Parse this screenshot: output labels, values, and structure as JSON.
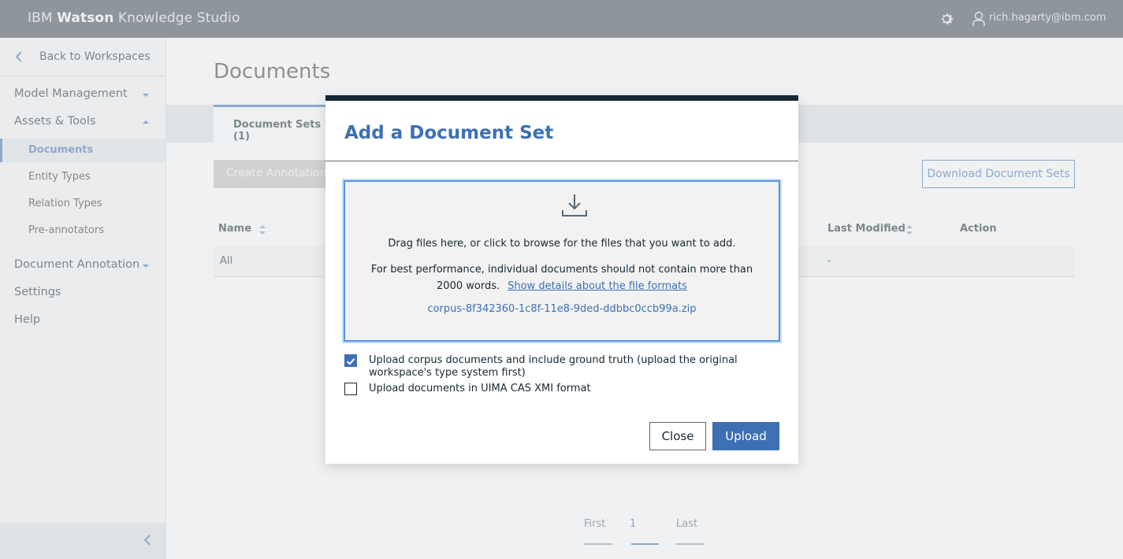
{
  "topbar": {
    "brand_prefix": "IBM ",
    "brand_bold": "Watson",
    "brand_suffix": " Knowledge Studio",
    "user_email": "rich.hagarty@ibm.com",
    "icons": [
      "gear-icon",
      "user-icon"
    ]
  },
  "sidebar": {
    "back_label": "Back to Workspaces",
    "sections": {
      "model_management": "Model Management",
      "assets_tools": "Assets & Tools",
      "document_annotation": "Document Annotation",
      "settings": "Settings",
      "help": "Help"
    },
    "sub_items": {
      "documents": "Documents",
      "entity_types": "Entity Types",
      "relation_types": "Relation Types",
      "pre_annotators": "Pre-annotators"
    }
  },
  "main": {
    "title": "Documents",
    "tab_label": "Document Sets (1)",
    "create_button": "Create Annotation Sets",
    "download_button": "Download Document Sets",
    "table": {
      "headers": {
        "name": "Name",
        "last_modified": "Last Modified",
        "action": "Action"
      },
      "rows": [
        {
          "name": "All",
          "last_modified": "-"
        }
      ]
    },
    "pager": {
      "first": "First",
      "page": "1",
      "last": "Last"
    }
  },
  "modal": {
    "title": "Add a Document Set",
    "dropzone_line1": "Drag files here, or click to browse for the files that you want to add.",
    "dropzone_line2": "For best performance, individual documents should not contain more than 2000 words.",
    "dropzone_link": "Show details about the file formats",
    "file_name": "corpus-8f342360-1c8f-11e8-9ded-ddbbc0ccb99a.zip",
    "checkbox_ground_truth": {
      "label": "Upload corpus documents and include ground truth (upload the original workspace's type system first)",
      "checked": true
    },
    "checkbox_uima": {
      "label": "Upload documents in UIMA CAS XMI format",
      "checked": false
    },
    "close_button": "Close",
    "upload_button": "Upload"
  },
  "colors": {
    "accent": "#3d70b2",
    "topbar": "#3d4751",
    "modal_top": "#172835"
  }
}
